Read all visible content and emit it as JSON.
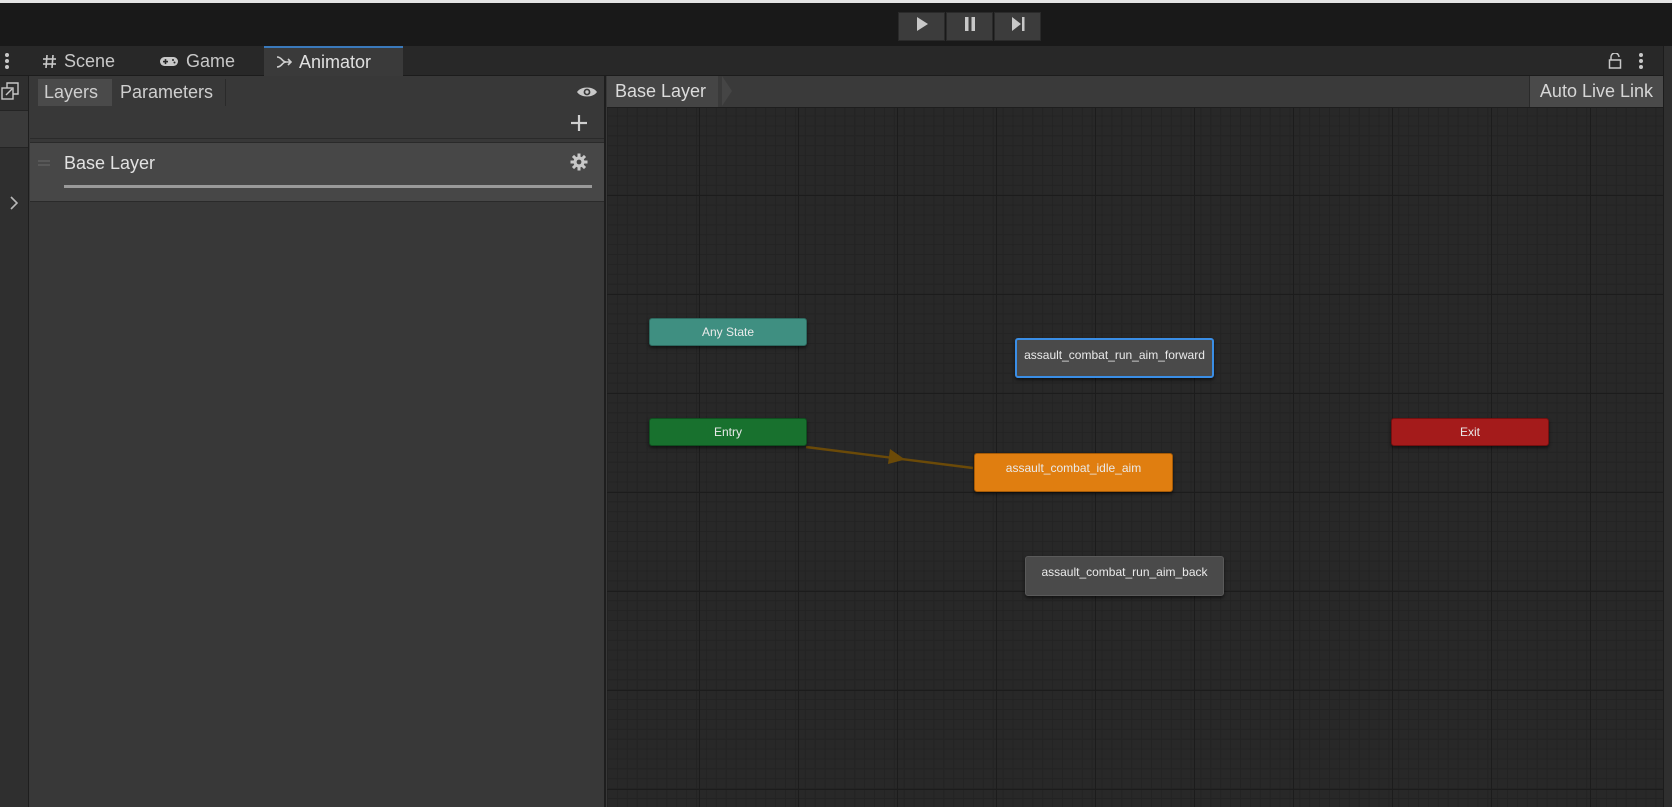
{
  "playback": {
    "play": "play-icon",
    "pause": "pause-icon",
    "step": "step-icon"
  },
  "tabs": [
    {
      "label": "Scene",
      "icon": "grid-icon"
    },
    {
      "label": "Game",
      "icon": "gamepad-icon"
    },
    {
      "label": "Animator",
      "icon": "animator-icon"
    }
  ],
  "layers_panel": {
    "tab_layers": "Layers",
    "tab_parameters": "Parameters",
    "layer_name": "Base Layer"
  },
  "graph": {
    "breadcrumb": "Base Layer",
    "auto_live_link": "Auto Live Link",
    "nodes": {
      "any_state": "Any State",
      "entry": "Entry",
      "exit": "Exit",
      "run_forward": "assault_combat_run_aim_forward",
      "idle_aim": "assault_combat_idle_aim",
      "run_back": "assault_combat_run_aim_back"
    }
  },
  "colors": {
    "any_state": "#3f8f81",
    "entry": "#18712e",
    "exit": "#a41b1b",
    "default_state": "#e07e10",
    "state": "#4a4a4a",
    "selection": "#3a8ee6",
    "transition": "#6b4a08"
  }
}
